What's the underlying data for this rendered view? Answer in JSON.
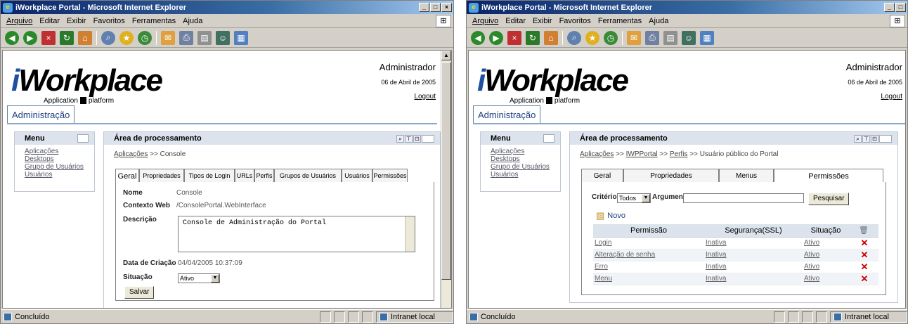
{
  "window": {
    "title": "iWorkplace Portal - Microsoft Internet Explorer",
    "controls": [
      "_",
      "□",
      "×"
    ]
  },
  "menubar": [
    "Arquivo",
    "Editar",
    "Exibir",
    "Favoritos",
    "Ferramentas",
    "Ajuda"
  ],
  "status": {
    "text": "Concluído",
    "zone": "Intranet local"
  },
  "header": {
    "logo_i": "i",
    "logo_rest": "Workplace",
    "logo_sub1": "Application",
    "logo_sub2": "platform",
    "user": "Administrador",
    "date": "06 de Abril de 2005",
    "logout": "Logout"
  },
  "main_tab": "Administração",
  "menu": {
    "title": "Menu",
    "items": [
      "Aplicações",
      "Desktops",
      "Grupo de Usuários",
      "Usuários"
    ]
  },
  "area_title": "Área de processamento",
  "left": {
    "breadcrumb": {
      "link": "Aplicações",
      "sep": ">>",
      "current": "Console"
    },
    "tabs": [
      "Geral",
      "Propriedades",
      "Tipos de Login",
      "URLs",
      "Perfis",
      "Grupos de Usuários",
      "Usuários",
      "Permissões"
    ],
    "active_tab": "Geral",
    "fields": {
      "nome_label": "Nome",
      "nome_value": "Console",
      "contexto_label": "Contexto Web",
      "contexto_value": "/ConsolePortal.WebInterface",
      "descricao_label": "Descrição",
      "descricao_value": "Console de Administração do Portal",
      "data_label": "Data de Criação",
      "data_value": "04/04/2005 10:37:09",
      "situacao_label": "Situação",
      "situacao_value": "Ativo"
    },
    "save_button": "Salvar"
  },
  "right": {
    "breadcrumb": {
      "link1": "Aplicações",
      "sep": ">>",
      "link2": "IWPPortal",
      "link3": "Perfis",
      "current": "Usuário público do Portal"
    },
    "tabs": [
      "Geral",
      "Propriedades",
      "Menus",
      "Permissões"
    ],
    "active_tab": "Permissões",
    "criterio_label": "Critério",
    "criterio_value": "Todos",
    "argumento_label": "Argumento",
    "search_button": "Pesquisar",
    "novo": "Novo",
    "columns": [
      "Permissão",
      "Segurança(SSL)",
      "Situação"
    ],
    "rows": [
      {
        "permissao": "Login",
        "ssl": "Inativa",
        "situacao": "Ativo"
      },
      {
        "permissao": "Alteração de senha",
        "ssl": "Inativa",
        "situacao": "Ativo"
      },
      {
        "permissao": "Erro",
        "ssl": "Inativa",
        "situacao": "Ativo"
      },
      {
        "permissao": "Menu",
        "ssl": "Inativa",
        "situacao": "Ativo"
      }
    ],
    "delete_glyph": "✕"
  }
}
